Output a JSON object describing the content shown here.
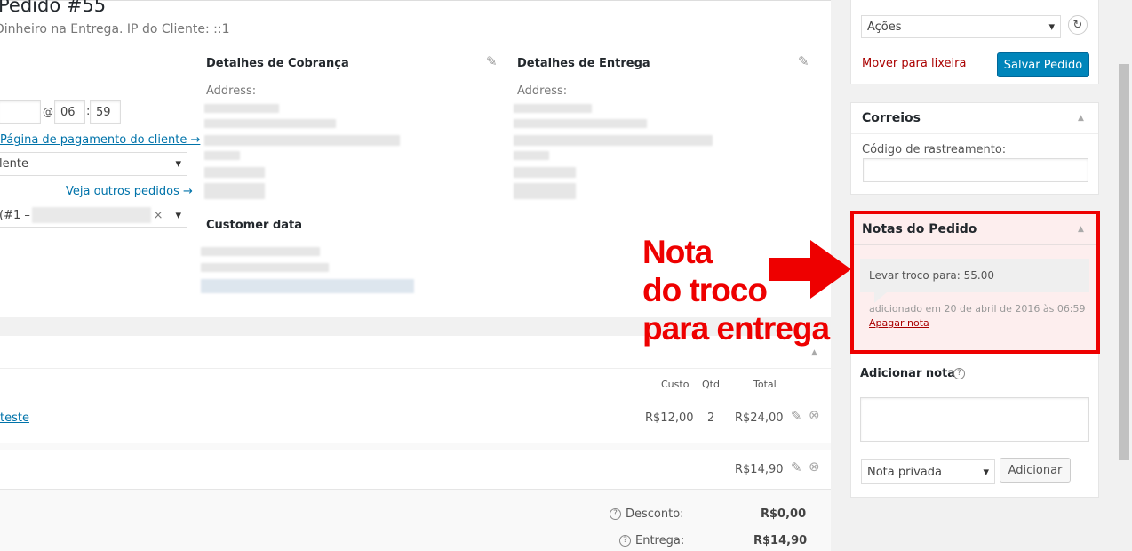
{
  "order": {
    "title": "Pedido #55",
    "subtitle": "Dinheiro na Entrega. IP do Cliente: ::1",
    "time": {
      "at": "@",
      "hour": "06",
      "sep": ":",
      "minute": "59"
    },
    "payment_link": "Página de pagamento do cliente →",
    "status_select": "lente",
    "other_orders_link": "Veja outros pedidos →",
    "customer_select": "(#1 –",
    "customer_clear": "×",
    "billing_title": "Detalhes de Cobrança",
    "shipping_title": "Detalhes de Entrega",
    "billing_address_label": "Address:",
    "shipping_address_label": "Address:",
    "customer_data_title": "Customer data"
  },
  "items": {
    "headers": {
      "cost": "Custo",
      "qty": "Qtd",
      "total": "Total"
    },
    "rows": [
      {
        "name": "teste",
        "cost": "R$12,00",
        "qty": "2",
        "total": "R$24,00"
      },
      {
        "name": "",
        "cost": "",
        "qty": "",
        "total": "R$14,90"
      }
    ],
    "totals": [
      {
        "label": "Desconto:",
        "value": "R$0,00"
      },
      {
        "label": "Entrega:",
        "value": "R$14,90"
      }
    ]
  },
  "actions_box": {
    "select": "Ações",
    "trash_link": "Mover para lixeira",
    "save_button": "Salvar Pedido"
  },
  "correios_box": {
    "title": "Correios",
    "tracking_label": "Código de rastreamento:",
    "tracking_value": ""
  },
  "notes_box": {
    "title": "Notas do Pedido",
    "note_text": "Levar troco para: 55.00",
    "note_meta": "adicionado em 20 de abril de 2016 às 06:59",
    "delete_link": "Apagar nota",
    "add_title": "Adicionar nota",
    "add_textarea": "",
    "note_type": "Nota privada",
    "add_button": "Adicionar"
  },
  "annotation": {
    "line1": "Nota",
    "line2": "do troco",
    "line3": "para entrega"
  },
  "icons": {
    "pencil": "✎",
    "refresh": "↻",
    "remove": "⊗",
    "help": "?",
    "caret_up": "▲",
    "caret_down": "▾"
  },
  "colors": {
    "accent": "#0085ba",
    "annotation_red": "#ee0000",
    "trash_red": "#a00",
    "note_bg": "#efefef"
  }
}
